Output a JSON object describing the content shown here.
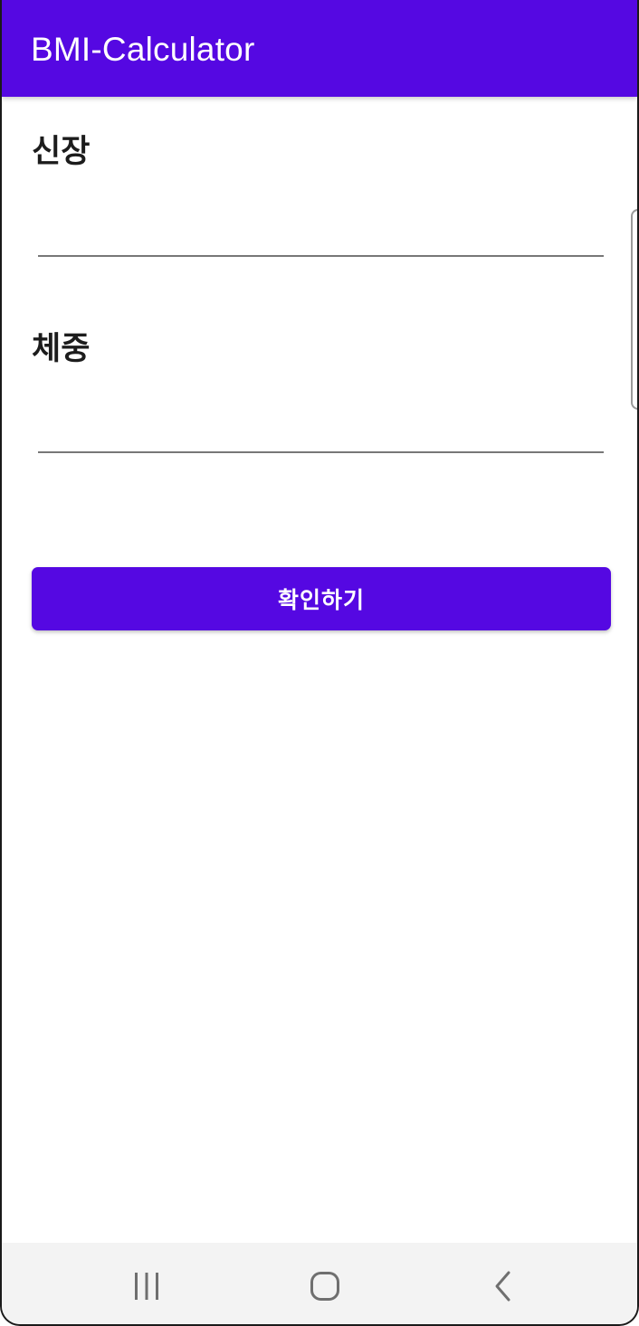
{
  "app_bar": {
    "title": "BMI-Calculator",
    "color": "#5508E2"
  },
  "form": {
    "height_label": "신장",
    "height_value": "",
    "weight_label": "체중",
    "weight_value": ""
  },
  "confirm_button": {
    "label": "확인하기"
  },
  "nav_bar": {
    "recents_icon": "recents-icon",
    "home_icon": "home-icon",
    "back_icon": "back-icon"
  }
}
